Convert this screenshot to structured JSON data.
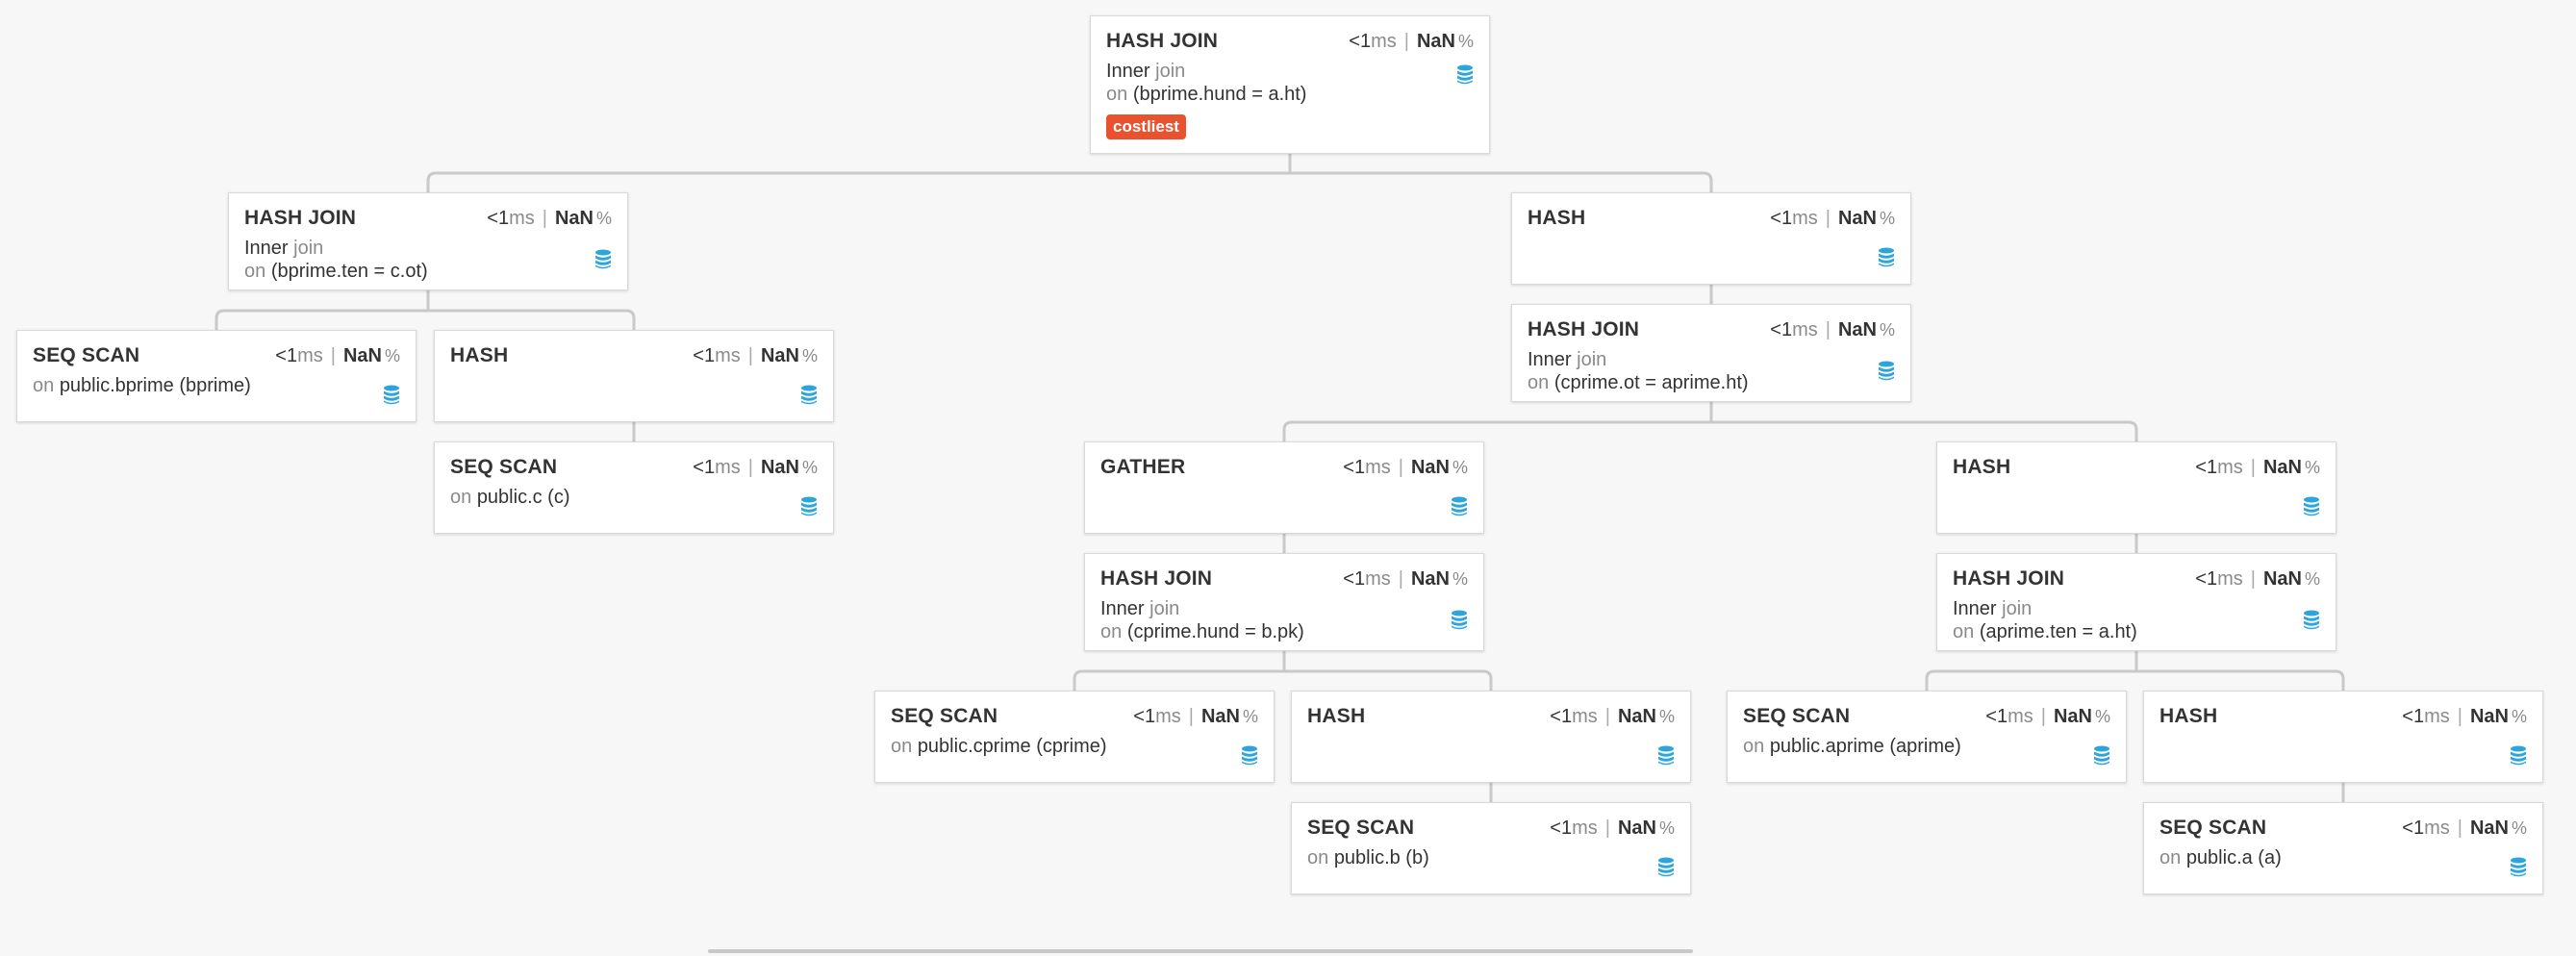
{
  "colors": {
    "background": "#f7f7f7",
    "edge": "#c9c9c9",
    "badge": "#e8522e",
    "db_icon": "#2ea4dc"
  },
  "nodes": [
    {
      "id": "n1",
      "title": "HASH JOIN",
      "time_value": "<1",
      "time_unit": "ms",
      "pct_value": "NaN",
      "pct_unit": "%",
      "join_type": "Inner",
      "join_word": "join",
      "on_word": "on",
      "condition": "(bprime.hund = a.ht)",
      "badge": "costliest",
      "icon": "database-icon"
    },
    {
      "id": "n2",
      "title": "HASH JOIN",
      "time_value": "<1",
      "time_unit": "ms",
      "pct_value": "NaN",
      "pct_unit": "%",
      "join_type": "Inner",
      "join_word": "join",
      "on_word": "on",
      "condition": "(bprime.ten = c.ot)",
      "icon": "database-icon"
    },
    {
      "id": "n3",
      "title": "HASH",
      "time_value": "<1",
      "time_unit": "ms",
      "pct_value": "NaN",
      "pct_unit": "%",
      "icon": "database-icon"
    },
    {
      "id": "n4",
      "title": "SEQ SCAN",
      "time_value": "<1",
      "time_unit": "ms",
      "pct_value": "NaN",
      "pct_unit": "%",
      "on_word": "on",
      "relation": "public.bprime (bprime)",
      "icon": "database-icon"
    },
    {
      "id": "n5",
      "title": "HASH",
      "time_value": "<1",
      "time_unit": "ms",
      "pct_value": "NaN",
      "pct_unit": "%",
      "icon": "database-icon"
    },
    {
      "id": "n6",
      "title": "HASH JOIN",
      "time_value": "<1",
      "time_unit": "ms",
      "pct_value": "NaN",
      "pct_unit": "%",
      "join_type": "Inner",
      "join_word": "join",
      "on_word": "on",
      "condition": "(cprime.ot = aprime.ht)",
      "icon": "database-icon"
    },
    {
      "id": "n7",
      "title": "SEQ SCAN",
      "time_value": "<1",
      "time_unit": "ms",
      "pct_value": "NaN",
      "pct_unit": "%",
      "on_word": "on",
      "relation": "public.c (c)",
      "icon": "database-icon"
    },
    {
      "id": "n8",
      "title": "GATHER",
      "time_value": "<1",
      "time_unit": "ms",
      "pct_value": "NaN",
      "pct_unit": "%",
      "icon": "database-icon"
    },
    {
      "id": "n9",
      "title": "HASH",
      "time_value": "<1",
      "time_unit": "ms",
      "pct_value": "NaN",
      "pct_unit": "%",
      "icon": "database-icon"
    },
    {
      "id": "n10",
      "title": "HASH JOIN",
      "time_value": "<1",
      "time_unit": "ms",
      "pct_value": "NaN",
      "pct_unit": "%",
      "join_type": "Inner",
      "join_word": "join",
      "on_word": "on",
      "condition": "(cprime.hund = b.pk)",
      "icon": "database-icon"
    },
    {
      "id": "n11",
      "title": "HASH JOIN",
      "time_value": "<1",
      "time_unit": "ms",
      "pct_value": "NaN",
      "pct_unit": "%",
      "join_type": "Inner",
      "join_word": "join",
      "on_word": "on",
      "condition": "(aprime.ten = a.ht)",
      "icon": "database-icon"
    },
    {
      "id": "n12",
      "title": "SEQ SCAN",
      "time_value": "<1",
      "time_unit": "ms",
      "pct_value": "NaN",
      "pct_unit": "%",
      "on_word": "on",
      "relation": "public.cprime (cprime)",
      "icon": "database-icon"
    },
    {
      "id": "n13",
      "title": "HASH",
      "time_value": "<1",
      "time_unit": "ms",
      "pct_value": "NaN",
      "pct_unit": "%",
      "icon": "database-icon"
    },
    {
      "id": "n14",
      "title": "SEQ SCAN",
      "time_value": "<1",
      "time_unit": "ms",
      "pct_value": "NaN",
      "pct_unit": "%",
      "on_word": "on",
      "relation": "public.aprime (aprime)",
      "icon": "database-icon"
    },
    {
      "id": "n15",
      "title": "HASH",
      "time_value": "<1",
      "time_unit": "ms",
      "pct_value": "NaN",
      "pct_unit": "%",
      "icon": "database-icon"
    },
    {
      "id": "n16",
      "title": "SEQ SCAN",
      "time_value": "<1",
      "time_unit": "ms",
      "pct_value": "NaN",
      "pct_unit": "%",
      "on_word": "on",
      "relation": "public.b (b)",
      "icon": "database-icon"
    },
    {
      "id": "n17",
      "title": "SEQ SCAN",
      "time_value": "<1",
      "time_unit": "ms",
      "pct_value": "NaN",
      "pct_unit": "%",
      "on_word": "on",
      "relation": "public.a (a)",
      "icon": "database-icon"
    }
  ],
  "edges": [
    [
      "n1",
      "n2"
    ],
    [
      "n1",
      "n3"
    ],
    [
      "n2",
      "n4"
    ],
    [
      "n2",
      "n5"
    ],
    [
      "n3",
      "n6"
    ],
    [
      "n5",
      "n7"
    ],
    [
      "n6",
      "n8"
    ],
    [
      "n6",
      "n9"
    ],
    [
      "n8",
      "n10"
    ],
    [
      "n9",
      "n11"
    ],
    [
      "n10",
      "n12"
    ],
    [
      "n10",
      "n13"
    ],
    [
      "n11",
      "n14"
    ],
    [
      "n11",
      "n15"
    ],
    [
      "n13",
      "n16"
    ],
    [
      "n15",
      "n17"
    ]
  ]
}
